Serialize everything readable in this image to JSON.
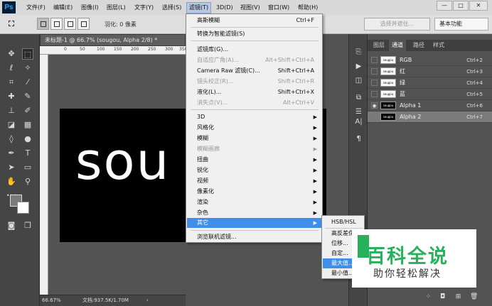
{
  "app": {
    "logo": "Ps"
  },
  "menubar": {
    "items": [
      "文件(F)",
      "编辑(E)",
      "图像(I)",
      "图层(L)",
      "文字(Y)",
      "选择(S)",
      "滤镜(T)",
      "3D(D)",
      "视图(V)",
      "窗口(W)",
      "帮助(H)"
    ],
    "active_index": 6
  },
  "window_controls": {
    "minimize": "—",
    "maximize": "□",
    "close": "✕"
  },
  "options_bar": {
    "feather_label": "羽化: 0 像素",
    "select_and_mask": "选择并遮住...",
    "workspace": "基本功能"
  },
  "document": {
    "tab_title": "未标题-1 @ 66.7% (sougou, Alpha 2/8) *",
    "ruler_ticks": [
      "0",
      "50",
      "100",
      "150",
      "200",
      "250",
      "300",
      "350"
    ],
    "canvas_text": "sou",
    "zoom": "66.67%",
    "doc_size": "文档:937.5K/1.70M"
  },
  "filter_menu": {
    "items": [
      {
        "label": "高斯模糊",
        "shortcut": "Ctrl+F",
        "disabled": false,
        "submenu": false
      },
      {
        "label": "转换为智能滤镜(S)",
        "shortcut": "",
        "disabled": false,
        "submenu": false
      },
      {
        "label": "滤镜库(G)...",
        "shortcut": "",
        "disabled": false,
        "submenu": false
      },
      {
        "label": "自适应广角(A)...",
        "shortcut": "Alt+Shift+Ctrl+A",
        "disabled": true,
        "submenu": false
      },
      {
        "label": "Camera Raw 滤镜(C)...",
        "shortcut": "Shift+Ctrl+A",
        "disabled": false,
        "submenu": false
      },
      {
        "label": "镜头校正(R)...",
        "shortcut": "Shift+Ctrl+R",
        "disabled": true,
        "submenu": false
      },
      {
        "label": "液化(L)...",
        "shortcut": "Shift+Ctrl+X",
        "disabled": false,
        "submenu": false
      },
      {
        "label": "消失点(V)...",
        "shortcut": "Alt+Ctrl+V",
        "disabled": true,
        "submenu": false
      },
      {
        "label": "3D",
        "shortcut": "",
        "disabled": false,
        "submenu": true
      },
      {
        "label": "风格化",
        "shortcut": "",
        "disabled": false,
        "submenu": true
      },
      {
        "label": "模糊",
        "shortcut": "",
        "disabled": false,
        "submenu": true
      },
      {
        "label": "模糊画廊",
        "shortcut": "",
        "disabled": true,
        "submenu": true
      },
      {
        "label": "扭曲",
        "shortcut": "",
        "disabled": false,
        "submenu": true
      },
      {
        "label": "锐化",
        "shortcut": "",
        "disabled": false,
        "submenu": true
      },
      {
        "label": "视频",
        "shortcut": "",
        "disabled": false,
        "submenu": true
      },
      {
        "label": "像素化",
        "shortcut": "",
        "disabled": false,
        "submenu": true
      },
      {
        "label": "渲染",
        "shortcut": "",
        "disabled": false,
        "submenu": true
      },
      {
        "label": "杂色",
        "shortcut": "",
        "disabled": false,
        "submenu": true
      },
      {
        "label": "其它",
        "shortcut": "",
        "disabled": false,
        "submenu": true,
        "highlighted": true
      },
      {
        "label": "浏览联机滤镜...",
        "shortcut": "",
        "disabled": false,
        "submenu": false
      }
    ]
  },
  "other_submenu": {
    "items": [
      {
        "label": "HSB/HSL"
      },
      {
        "label": "高反差保留..."
      },
      {
        "label": "位移..."
      },
      {
        "label": "自定..."
      },
      {
        "label": "最大值...",
        "highlighted": true
      },
      {
        "label": "最小值..."
      }
    ]
  },
  "channels_panel": {
    "tabs": [
      "图层",
      "通道",
      "路径",
      "样式"
    ],
    "active_tab": 1,
    "rows": [
      {
        "name": "RGB",
        "shortcut": "Ctrl+2",
        "thumb": "sougou",
        "visible": false
      },
      {
        "name": "红",
        "shortcut": "Ctrl+3",
        "thumb": "sougou",
        "visible": false
      },
      {
        "name": "绿",
        "shortcut": "Ctrl+4",
        "thumb": "sougou",
        "visible": false
      },
      {
        "name": "蓝",
        "shortcut": "Ctrl+5",
        "thumb": "sougou",
        "visible": false
      },
      {
        "name": "Alpha 1",
        "shortcut": "Ctrl+6",
        "thumb": "sougou",
        "visible": true
      },
      {
        "name": "Alpha 2",
        "shortcut": "Ctrl+7",
        "thumb": "sougou",
        "visible": false,
        "selected": true
      }
    ]
  },
  "watermark": {
    "title": "百科全说",
    "subtitle": "助你轻松解决",
    "color": "#27b15a"
  }
}
